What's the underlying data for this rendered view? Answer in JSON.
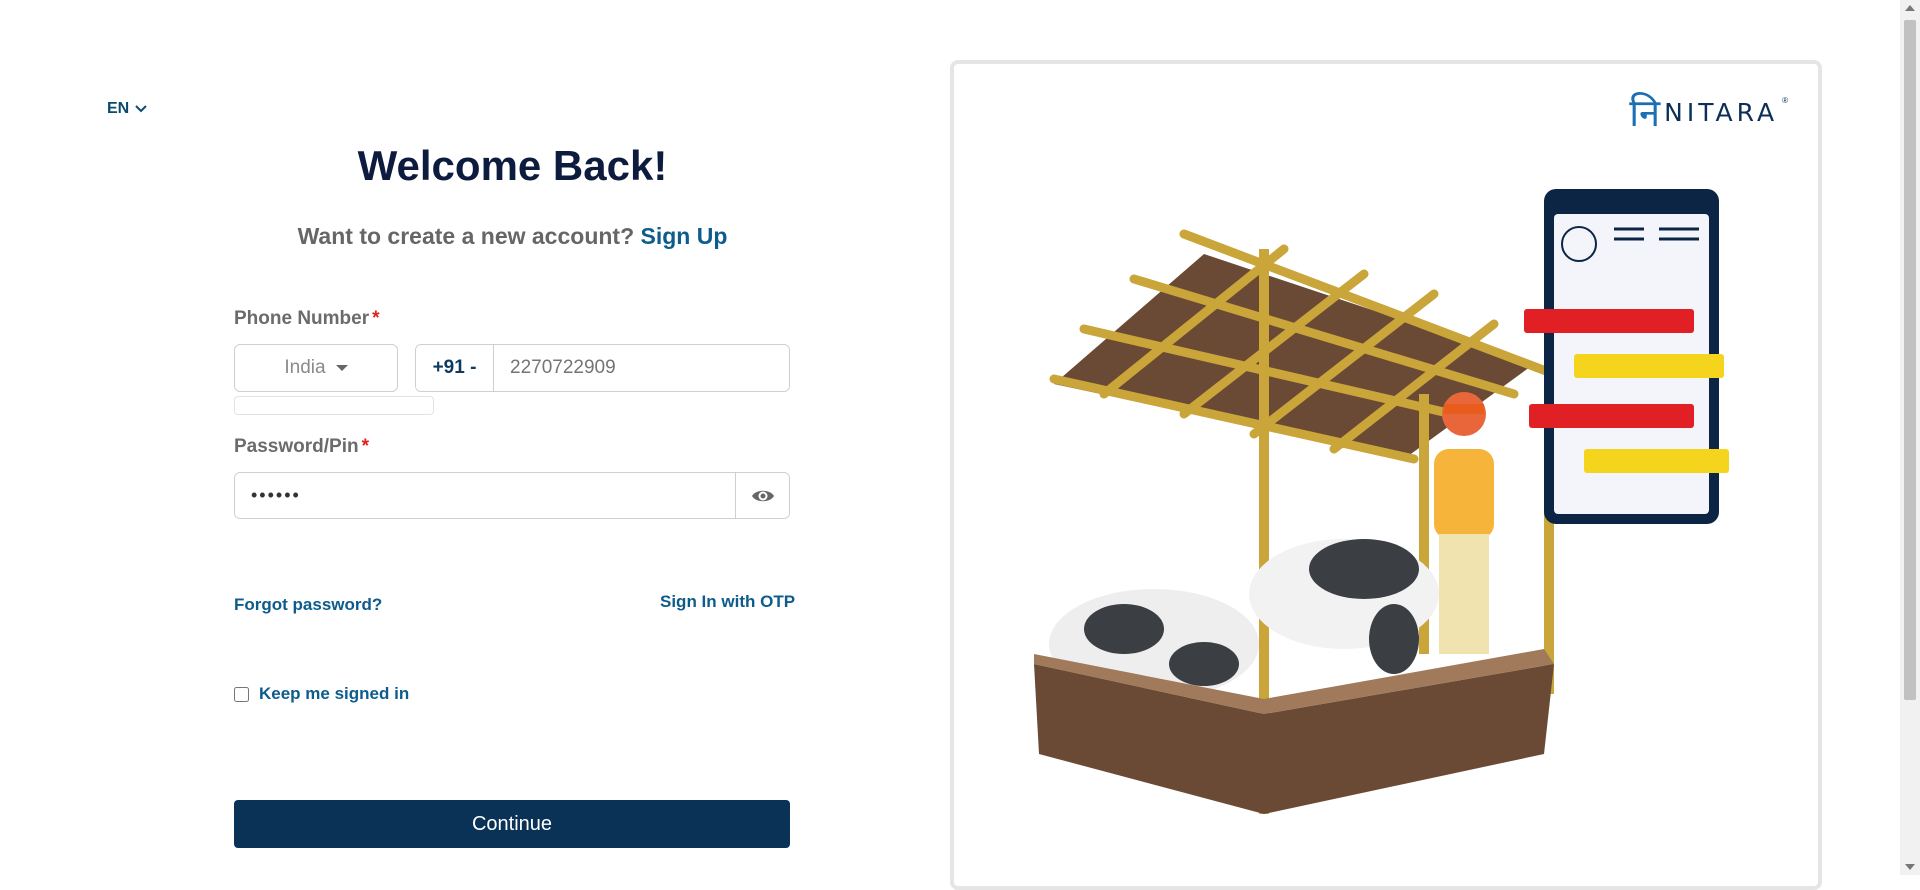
{
  "language": {
    "current": "EN"
  },
  "welcome": {
    "title": "Welcome Back!",
    "prompt": "Want to create a new account?",
    "signup_link": "Sign Up"
  },
  "phone": {
    "label": "Phone Number",
    "required_mark": "*",
    "country": "India",
    "dial_code": "+91 -",
    "placeholder": "2270722909"
  },
  "password": {
    "label": "Password/Pin",
    "required_mark": "*",
    "value": "••••••"
  },
  "links": {
    "forgot_password": "Forgot password?",
    "otp_signin": "Sign In with OTP"
  },
  "keep_signed_in": {
    "label": "Keep me signed in",
    "checked": false
  },
  "continue_label": "Continue",
  "brand": {
    "name": "NITARA",
    "glyph": "नि",
    "registered": "®"
  },
  "colors": {
    "primary": "#0a3257",
    "link": "#0d5c8c",
    "required": "#e02020"
  }
}
